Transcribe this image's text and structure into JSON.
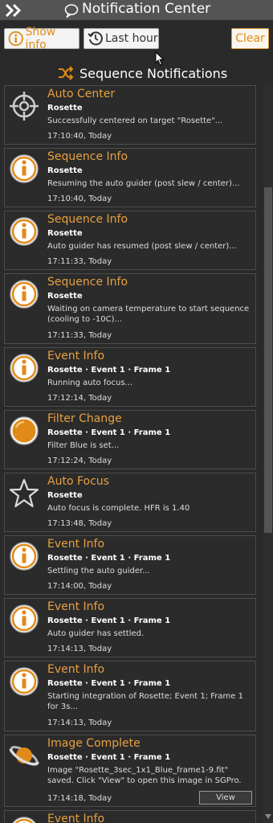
{
  "window": {
    "title": "Notification Center"
  },
  "toolbar": {
    "show_info": "Show info",
    "last_hour": "Last hour",
    "clear": "Clear"
  },
  "section": {
    "title": "Sequence Notifications"
  },
  "colors": {
    "accent": "#e8a040",
    "icon_orange": "#e08a18",
    "card_border": "#4d4d4d"
  },
  "notifications": [
    {
      "icon": "crosshair-icon",
      "title": "Auto Center",
      "target": "Rosette",
      "message": "Successfully centered on target \"Rosette\"...",
      "time": "17:10:40, Today"
    },
    {
      "icon": "info-icon",
      "title": "Sequence Info",
      "target": "Rosette",
      "message": "Resuming the auto guider (post slew / center)...",
      "time": "17:10:40, Today"
    },
    {
      "icon": "info-icon",
      "title": "Sequence Info",
      "target": "Rosette",
      "message": "Auto guider has resumed (post slew / center)...",
      "time": "17:11:33, Today"
    },
    {
      "icon": "info-icon",
      "title": "Sequence Info",
      "target": "Rosette",
      "message": "Waiting on camera temperature to start sequence (cooling to -10C)...",
      "time": "17:11:33, Today"
    },
    {
      "icon": "info-icon",
      "title": "Event Info",
      "target": "Rosette · Event 1 · Frame 1",
      "message": "Running auto focus...",
      "time": "17:12:14, Today"
    },
    {
      "icon": "filter-icon",
      "title": "Filter Change",
      "target": "Rosette · Event 1 · Frame 1",
      "message": "Filter Blue is set...",
      "time": "17:12:24, Today"
    },
    {
      "icon": "star-icon",
      "title": "Auto Focus",
      "target": "Rosette",
      "message": "Auto focus is complete. HFR is 1.40",
      "time": "17:13:48, Today"
    },
    {
      "icon": "info-icon",
      "title": "Event Info",
      "target": "Rosette · Event 1 · Frame 1",
      "message": "Settling the auto guider...",
      "time": "17:14:00, Today"
    },
    {
      "icon": "info-icon",
      "title": "Event Info",
      "target": "Rosette · Event 1 · Frame 1",
      "message": "Auto guider has settled.",
      "time": "17:14:13, Today"
    },
    {
      "icon": "info-icon",
      "title": "Event Info",
      "target": "Rosette · Event 1 · Frame 1",
      "message": "Starting integration of Rosette; Event 1; Frame 1 for 3s...",
      "time": "17:14:13, Today"
    },
    {
      "icon": "saturn-icon",
      "title": "Image Complete",
      "target": "Rosette · Event 1 · Frame 1",
      "message": "Image \"Rosette_3sec_1x1_Blue_frame1-9.fit\" saved. Click \"View\" to open this image in SGPro.",
      "time": "17:14:18, Today",
      "button": "View"
    },
    {
      "icon": "info-icon",
      "title": "Event Info"
    }
  ]
}
